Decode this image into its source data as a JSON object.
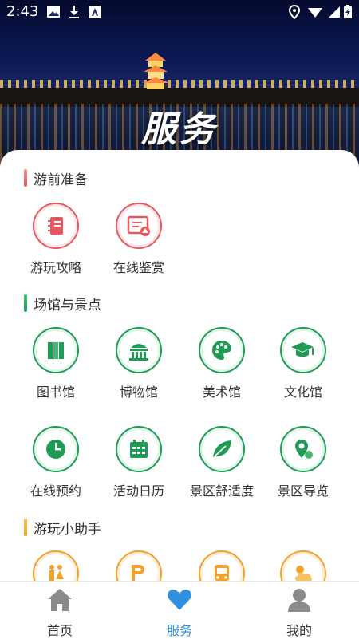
{
  "status_bar": {
    "time": "2:43",
    "icons": [
      "image-icon",
      "download-icon",
      "a-icon",
      "location-icon",
      "wifi-icon",
      "battery-charging-icon"
    ]
  },
  "hero": {
    "title": "服务"
  },
  "sections": [
    {
      "title": "游前准备",
      "accent": "#e6585f",
      "items": [
        {
          "label": "游玩攻略",
          "icon": "notebook-icon"
        },
        {
          "label": "在线鉴赏",
          "icon": "picture-frame-icon"
        }
      ]
    },
    {
      "title": "场馆与景点",
      "accent": "#1f9b56",
      "items": [
        {
          "label": "图书馆",
          "icon": "books-icon"
        },
        {
          "label": "博物馆",
          "icon": "museum-icon"
        },
        {
          "label": "美术馆",
          "icon": "palette-icon"
        },
        {
          "label": "文化馆",
          "icon": "graduation-cap-icon"
        },
        {
          "label": "在线预约",
          "icon": "clock-icon"
        },
        {
          "label": "活动日历",
          "icon": "calendar-icon"
        },
        {
          "label": "景区舒适度",
          "icon": "leaf-icon"
        },
        {
          "label": "景区导览",
          "icon": "map-pin-icon"
        }
      ]
    },
    {
      "title": "游玩小助手",
      "accent": "#f2a12b",
      "items": [
        {
          "label": "",
          "icon": "restroom-icon"
        },
        {
          "label": "",
          "icon": "parking-icon"
        },
        {
          "label": "",
          "icon": "bus-icon"
        },
        {
          "label": "",
          "icon": "weather-icon"
        }
      ]
    }
  ],
  "tabbar": {
    "tabs": [
      {
        "label": "首页",
        "icon": "home-icon"
      },
      {
        "label": "服务",
        "icon": "heart-icon",
        "active": true
      },
      {
        "label": "我的",
        "icon": "user-icon"
      }
    ]
  }
}
